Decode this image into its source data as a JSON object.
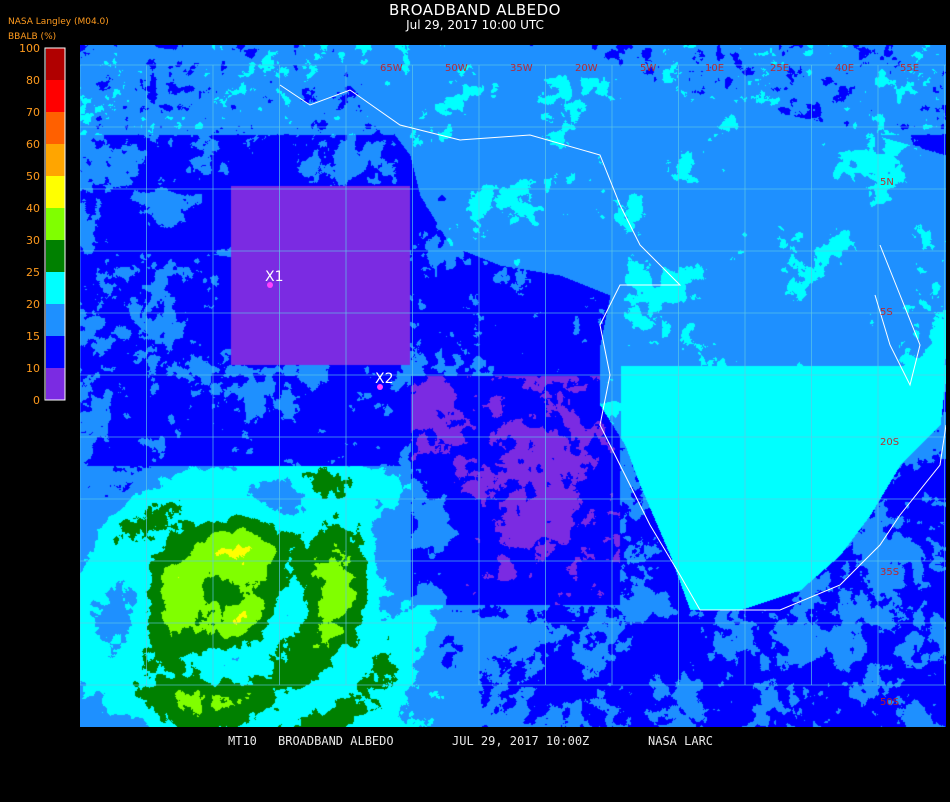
{
  "header": {
    "title": "BROADBAND ALBEDO",
    "subtitle": "Jul 29, 2017 10:00 UTC",
    "source": "NASA Langley (M04.0)",
    "units": "BBALB (%)"
  },
  "colorbar": {
    "ticks": [
      "100",
      "80",
      "70",
      "60",
      "50",
      "40",
      "30",
      "25",
      "20",
      "15",
      "10",
      "0"
    ],
    "bins": [
      {
        "min": 80,
        "max": 100,
        "color": "#b00000"
      },
      {
        "min": 70,
        "max": 80,
        "color": "#ff0000"
      },
      {
        "min": 60,
        "max": 70,
        "color": "#ff6000"
      },
      {
        "min": 50,
        "max": 60,
        "color": "#ffa500"
      },
      {
        "min": 40,
        "max": 50,
        "color": "#ffff00"
      },
      {
        "min": 30,
        "max": 40,
        "color": "#80ff00"
      },
      {
        "min": 25,
        "max": 30,
        "color": "#008000"
      },
      {
        "min": 20,
        "max": 25,
        "color": "#00ffff"
      },
      {
        "min": 15,
        "max": 20,
        "color": "#1e90ff"
      },
      {
        "min": 10,
        "max": 15,
        "color": "#0000ff"
      },
      {
        "min": 0,
        "max": 10,
        "color": "#7b2be2"
      }
    ]
  },
  "map": {
    "lon_labels": [
      "55E",
      "40E",
      "25E",
      "10E",
      "5W",
      "20W",
      "35W",
      "50W",
      "65W"
    ],
    "lat_labels": [
      "5N",
      "5S",
      "20S",
      "35S",
      "50S"
    ],
    "markers": [
      {
        "label": "X1"
      },
      {
        "label": "X2"
      }
    ],
    "grid_color": "#5fc8e6",
    "coast_color": "#ffffff"
  },
  "footer": {
    "satellite": "MT10",
    "product": "BROADBAND ALBEDO",
    "date": "JUL 29, 2017 10:00Z",
    "credit": "NASA LARC"
  }
}
